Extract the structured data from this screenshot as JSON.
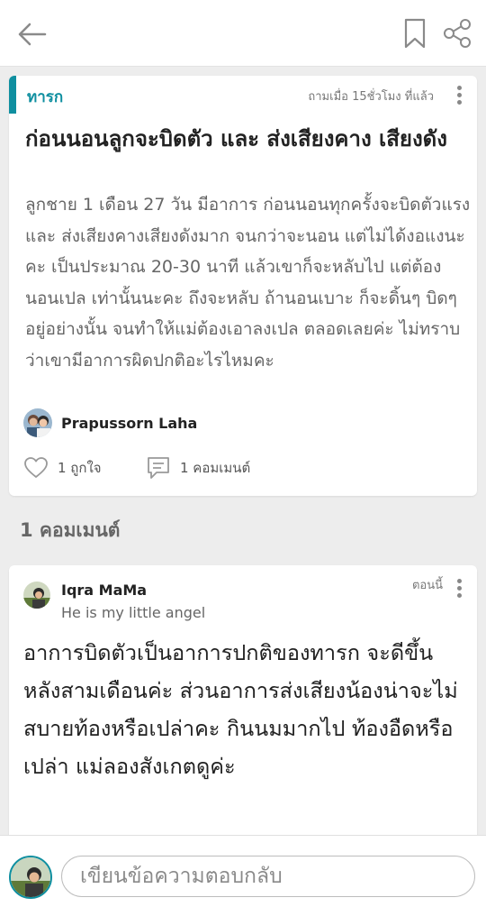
{
  "topbar": {
    "back_icon": "arrow-left-icon",
    "bookmark_icon": "bookmark-icon",
    "share_icon": "share-icon"
  },
  "post": {
    "category": "ทารก",
    "time_ago": "ถามเมื่อ 15ชั่วโมง ที่แล้ว",
    "title": "ก่อนนอนลูกจะบิดตัว และ ส่งเสียงคาง เสียงดัง",
    "body": "ลูกชาย 1 เดือน 27 วัน มีอาการ ก่อนนอนทุกครั้งจะบิดตัวแรง และ ส่งเสียงคางเสียงดังมาก จนกว่าจะนอน แต่ไม่ได้งอแงนะคะ เป็นประมาณ 20-30 นาที แล้วเขาก็จะหลับไป แต่ต้องนอนเปล เท่านั้นนะคะ ถึงจะหลับ ถ้านอนเบาะ ก็จะดิ้นๆ บิดๆ อยู่อย่างนั้น จนทำให้แม่ต้องเอาลงเปล ตลอดเลยค่ะ ไม่ทราบว่าเขามีอาการผิดปกติอะไรไหมคะ",
    "author": "Prapussorn Laha",
    "likes_label": "1 ถูกใจ",
    "comments_label": "1 คอมเมนต์"
  },
  "comments_heading": "1 คอมเมนต์",
  "comment": {
    "name": "Iqra MaMa",
    "subtitle": "He is my little angel",
    "time": "ตอนนี้",
    "text": "อาการบิดตัวเป็นอาการปกติของทารก จะดีขึ้นหลังสามเดือนค่ะ ส่วนอาการส่งเสียงน้องน่าจะไม่สบายท้องหรือเปล่าคะ กินนมมากไป ท้องอืดหรือเปล่า แม่ลองสังเกตดูค่ะ"
  },
  "reply": {
    "placeholder": "เขียนข้อความตอบกลับ"
  },
  "colors": {
    "accent": "#0f8fa0",
    "background": "#ededed",
    "card": "#ffffff"
  }
}
